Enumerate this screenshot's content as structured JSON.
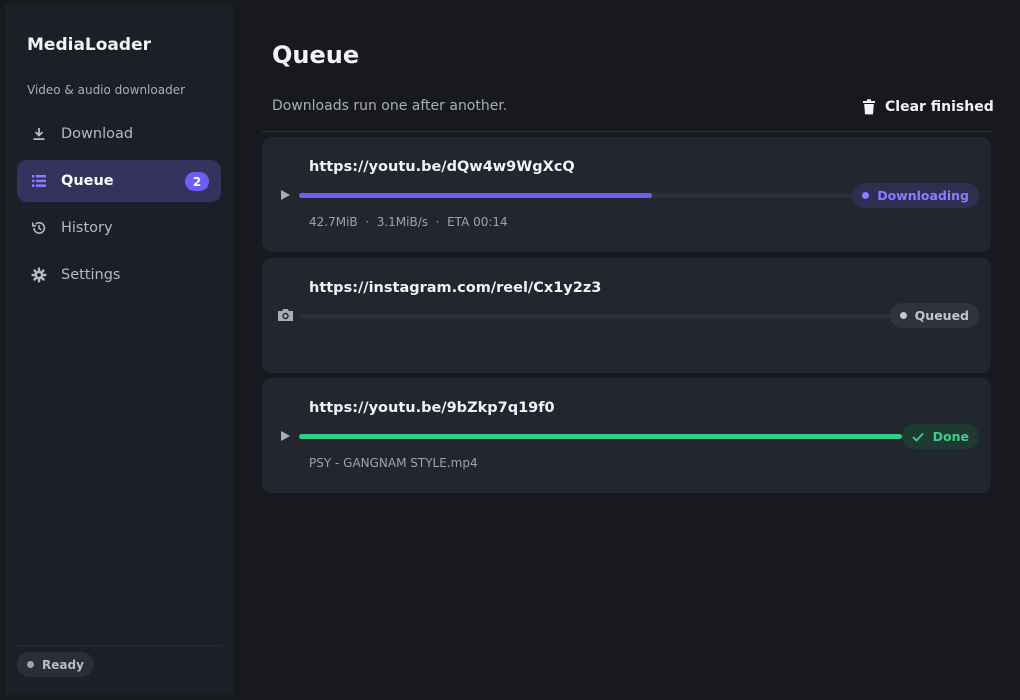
{
  "sidebar": {
    "app_title": "MediaLoader",
    "app_subtitle": "Video & audio downloader",
    "nav": [
      {
        "label": "Download",
        "icon": "download-icon"
      },
      {
        "label": "Queue",
        "icon": "list-icon",
        "active": true,
        "badge": "2"
      },
      {
        "label": "History",
        "icon": "history-icon"
      },
      {
        "label": "Settings",
        "icon": "gear-icon"
      }
    ],
    "status": "Ready"
  },
  "main": {
    "title": "Queue",
    "subtitle": "Downloads run one after another.",
    "clear_label": "Clear finished",
    "items": [
      {
        "url": "https://youtu.be/dQw4w9WgXcQ",
        "kind_icon": "play-icon",
        "progress": 0.63,
        "meta": "42.7MiB  ·  3.1MiB/s  ·  ETA 00:14",
        "status": "Downloading",
        "status_color": "#8a7dff",
        "status_bg": "#2f2e52",
        "fill_color": "#6d5ff2"
      },
      {
        "url": "https://instagram.com/reel/Cx1y2z3",
        "kind_icon": "camera-icon",
        "progress": 0,
        "meta": "",
        "status": "Queued",
        "status_color": "#c3c6ce",
        "status_bg": "#2f333c",
        "fill_color": "#6d5ff2"
      },
      {
        "url": "https://youtu.be/9bZkp7q19f0",
        "kind_icon": "play-icon",
        "progress": 1.0,
        "meta": "PSY - GANGNAM STYLE.mp4",
        "status": "Done",
        "status_color": "#3ccf8a",
        "status_bg": "#1f3a33",
        "fill_color": "#2fce86"
      }
    ]
  }
}
